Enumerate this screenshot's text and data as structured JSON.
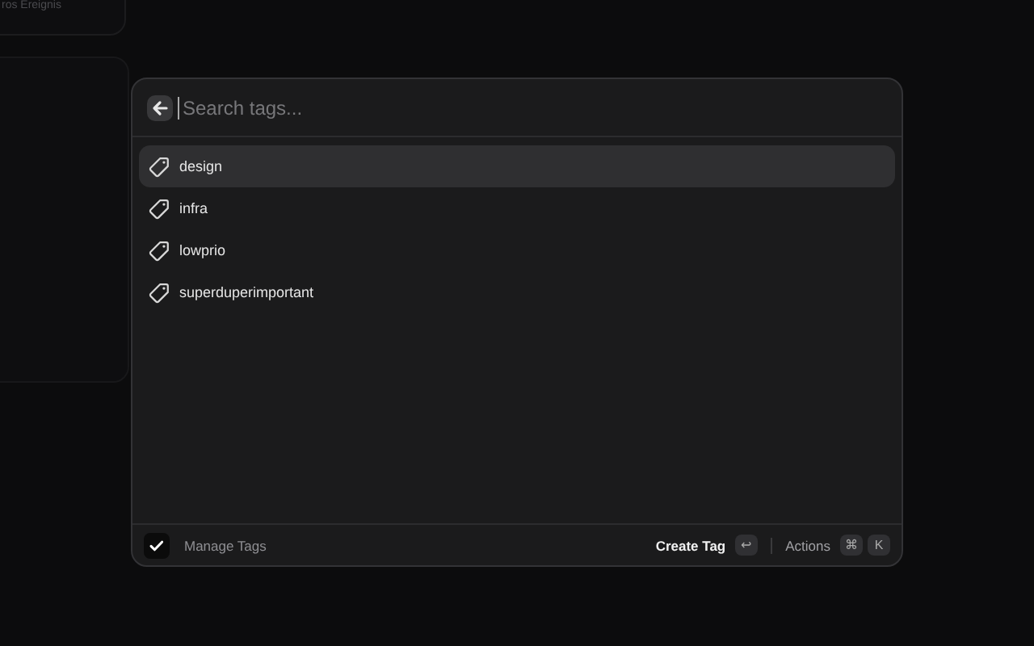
{
  "background": {
    "card_title": "ros Ereignis"
  },
  "search": {
    "placeholder": "Search tags..."
  },
  "tags": [
    {
      "label": "design",
      "selected": true
    },
    {
      "label": "infra",
      "selected": false
    },
    {
      "label": "lowprio",
      "selected": false
    },
    {
      "label": "superduperimportant",
      "selected": false
    }
  ],
  "footer": {
    "title": "Manage Tags",
    "primary_action": "Create Tag",
    "primary_key": "↩",
    "actions_label": "Actions",
    "actions_keys": [
      "⌘",
      "K"
    ]
  }
}
